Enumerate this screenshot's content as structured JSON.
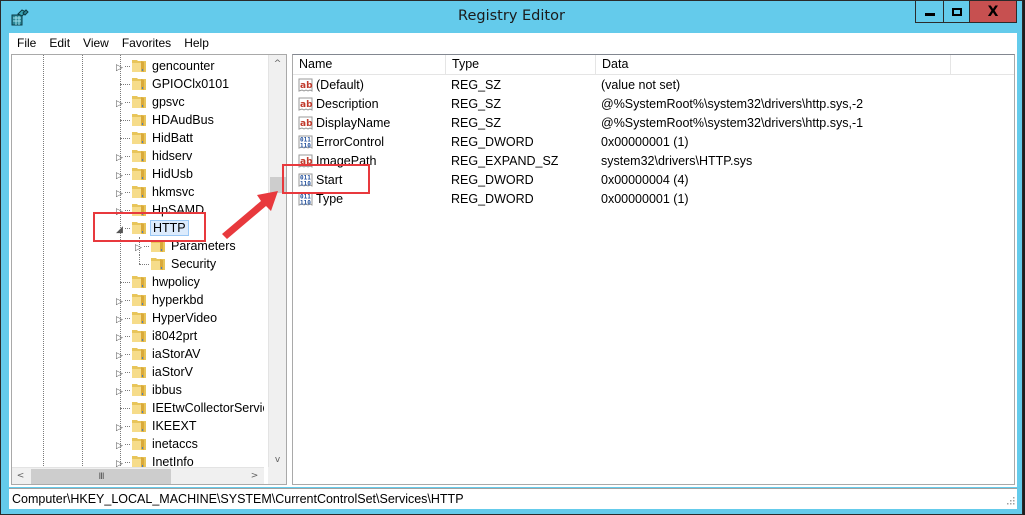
{
  "window": {
    "title": "Registry Editor",
    "app_icon": "registry-editor-icon",
    "controls": {
      "minimize": "minimize-icon",
      "maximize": "maximize-icon",
      "close": "close-icon",
      "close_glyph": "X"
    }
  },
  "menu": [
    "File",
    "Edit",
    "View",
    "Favorites",
    "Help"
  ],
  "tree": {
    "nodes": [
      {
        "label": "gencounter",
        "level": 0,
        "expander": "collapsed"
      },
      {
        "label": "GPIOClx0101",
        "level": 0,
        "expander": "none"
      },
      {
        "label": "gpsvc",
        "level": 0,
        "expander": "collapsed"
      },
      {
        "label": "HDAudBus",
        "level": 0,
        "expander": "none"
      },
      {
        "label": "HidBatt",
        "level": 0,
        "expander": "none"
      },
      {
        "label": "hidserv",
        "level": 0,
        "expander": "collapsed"
      },
      {
        "label": "HidUsb",
        "level": 0,
        "expander": "collapsed"
      },
      {
        "label": "hkmsvc",
        "level": 0,
        "expander": "collapsed"
      },
      {
        "label": "HpSAMD",
        "level": 0,
        "expander": "collapsed"
      },
      {
        "label": "HTTP",
        "level": 0,
        "expander": "expanded",
        "selected": true
      },
      {
        "label": "Parameters",
        "level": 1,
        "expander": "collapsed"
      },
      {
        "label": "Security",
        "level": 1,
        "expander": "none"
      },
      {
        "label": "hwpolicy",
        "level": 0,
        "expander": "none"
      },
      {
        "label": "hyperkbd",
        "level": 0,
        "expander": "collapsed"
      },
      {
        "label": "HyperVideo",
        "level": 0,
        "expander": "collapsed"
      },
      {
        "label": "i8042prt",
        "level": 0,
        "expander": "collapsed"
      },
      {
        "label": "iaStorAV",
        "level": 0,
        "expander": "collapsed"
      },
      {
        "label": "iaStorV",
        "level": 0,
        "expander": "collapsed"
      },
      {
        "label": "ibbus",
        "level": 0,
        "expander": "collapsed"
      },
      {
        "label": "IEEtwCollectorService",
        "level": 0,
        "expander": "none"
      },
      {
        "label": "IKEEXT",
        "level": 0,
        "expander": "collapsed"
      },
      {
        "label": "inetaccs",
        "level": 0,
        "expander": "collapsed"
      },
      {
        "label": "InetInfo",
        "level": 0,
        "expander": "collapsed"
      }
    ],
    "scroll": {
      "up_glyph": "^",
      "down_glyph": "v",
      "left_glyph": "<",
      "right_glyph": ">",
      "thumb_grip": "III"
    }
  },
  "values": {
    "columns": [
      "Name",
      "Type",
      "Data"
    ],
    "rows": [
      {
        "name": "(Default)",
        "type": "REG_SZ",
        "data": "(value not set)",
        "icon": "string-value-icon"
      },
      {
        "name": "Description",
        "type": "REG_SZ",
        "data": "@%SystemRoot%\\system32\\drivers\\http.sys,-2",
        "icon": "string-value-icon"
      },
      {
        "name": "DisplayName",
        "type": "REG_SZ",
        "data": "@%SystemRoot%\\system32\\drivers\\http.sys,-1",
        "icon": "string-value-icon"
      },
      {
        "name": "ErrorControl",
        "type": "REG_DWORD",
        "data": "0x00000001 (1)",
        "icon": "binary-value-icon"
      },
      {
        "name": "ImagePath",
        "type": "REG_EXPAND_SZ",
        "data": "system32\\drivers\\HTTP.sys",
        "icon": "string-value-icon"
      },
      {
        "name": "Start",
        "type": "REG_DWORD",
        "data": "0x00000004 (4)",
        "icon": "binary-value-icon"
      },
      {
        "name": "Type",
        "type": "REG_DWORD",
        "data": "0x00000001 (1)",
        "icon": "binary-value-icon"
      }
    ]
  },
  "status_bar": {
    "path": "Computer\\HKEY_LOCAL_MACHINE\\SYSTEM\\CurrentControlSet\\Services\\HTTP"
  },
  "annotations": {
    "color": "#e8393d",
    "highlighted_key": "HTTP",
    "highlighted_value": "Start"
  }
}
